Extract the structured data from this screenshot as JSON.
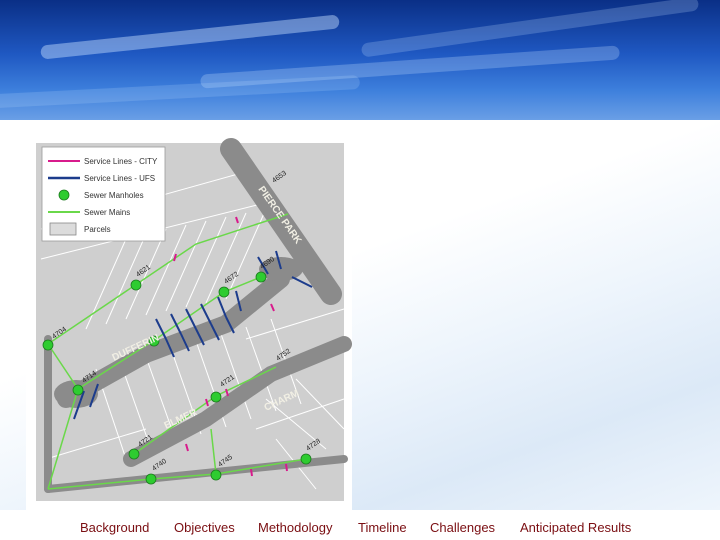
{
  "nav": {
    "items": [
      "Background",
      "Objectives",
      "Methodology",
      "Timeline",
      "Challenges",
      "Anticipated Results"
    ],
    "color": "#7a0e12"
  },
  "map": {
    "legend": {
      "items": [
        {
          "label": "Service Lines - CITY",
          "symbol": "line",
          "color": "#d81b8c"
        },
        {
          "label": "Service Lines - UFS",
          "symbol": "line",
          "color": "#1c3c8c"
        },
        {
          "label": "Sewer Manholes",
          "symbol": "dot",
          "color": "#2ecc30"
        },
        {
          "label": "Sewer Mains",
          "symbol": "line",
          "color": "#6ad84a"
        },
        {
          "label": "Parcels",
          "symbol": "box",
          "color": "#dcdcdc"
        }
      ]
    },
    "streets": [
      "PIERCE PARK",
      "DUFFERIN",
      "CHARM",
      "ELMER"
    ],
    "addresses": [
      "4653",
      "4621",
      "4672",
      "4690",
      "4704",
      "4714",
      "4752",
      "4721",
      "4721",
      "4740",
      "4745",
      "4728",
      "4761",
      "4754",
      "4755"
    ],
    "colors": {
      "street": "#8b8b8b",
      "background": "#cfcfcf",
      "service_city": "#d81b8c",
      "service_ufs": "#1c3c8c",
      "manhole": "#2ecc30",
      "main": "#6ad84a"
    }
  }
}
